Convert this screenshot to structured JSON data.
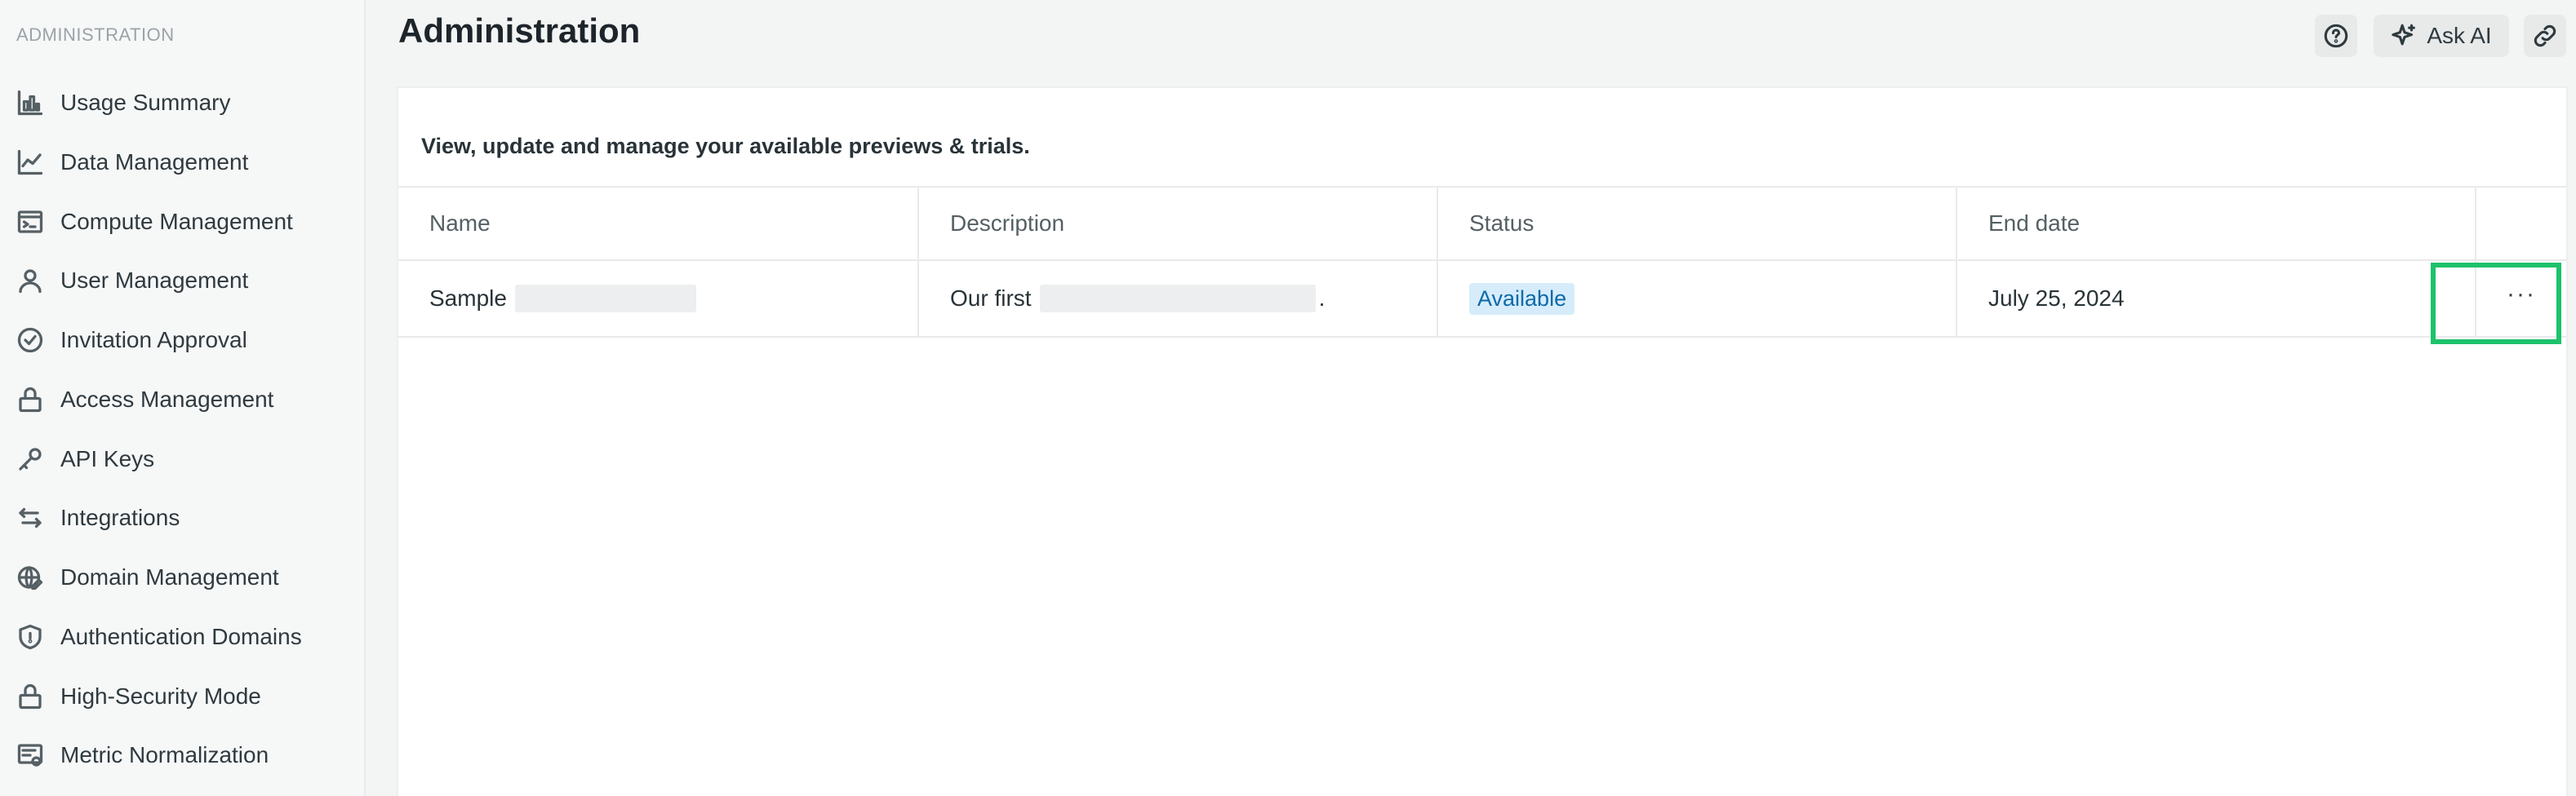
{
  "sidebar": {
    "heading": "ADMINISTRATION",
    "items": [
      {
        "label": "Usage Summary",
        "icon": "bar-chart-icon"
      },
      {
        "label": "Data Management",
        "icon": "line-chart-icon"
      },
      {
        "label": "Compute Management",
        "icon": "terminal-icon"
      },
      {
        "label": "User Management",
        "icon": "user-icon"
      },
      {
        "label": "Invitation Approval",
        "icon": "check-circle-icon"
      },
      {
        "label": "Access Management",
        "icon": "lock-icon"
      },
      {
        "label": "API Keys",
        "icon": "key-icon"
      },
      {
        "label": "Integrations",
        "icon": "arrows-swap-icon"
      },
      {
        "label": "Domain Management",
        "icon": "globe-edit-icon"
      },
      {
        "label": "Authentication Domains",
        "icon": "shield-icon"
      },
      {
        "label": "High-Security Mode",
        "icon": "lock-icon"
      },
      {
        "label": "Metric Normalization",
        "icon": "settings-list-icon"
      }
    ]
  },
  "header": {
    "title": "Administration",
    "ask_ai_label": "Ask AI"
  },
  "card": {
    "description": "View, update and manage your available previews & trials."
  },
  "table": {
    "columns": [
      "Name",
      "Description",
      "Status",
      "End date"
    ],
    "rows": [
      {
        "name": "Sample",
        "description": "Our first",
        "description_end": ".",
        "status": "Available",
        "end_date": "July 25, 2024",
        "more": "···"
      }
    ]
  },
  "colors": {
    "highlight": "#1dc26b",
    "badge_bg": "#d6ecfa",
    "badge_text": "#0b6aa8"
  }
}
